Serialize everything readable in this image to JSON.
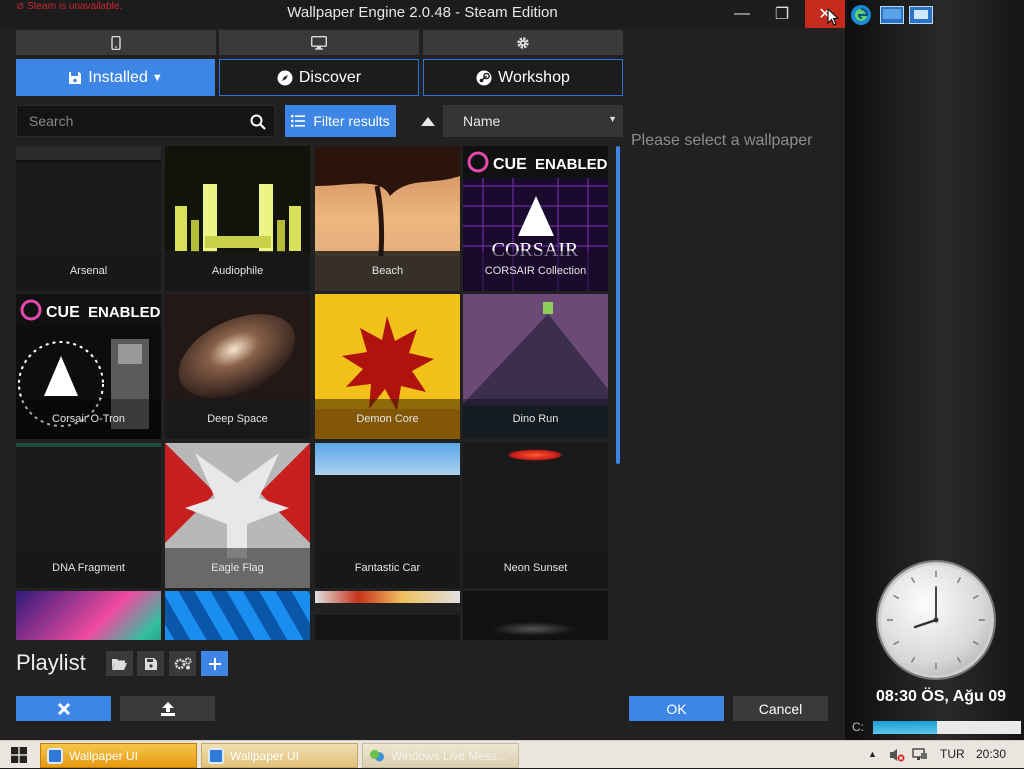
{
  "window": {
    "steam_warning": "Steam is unavailable.",
    "title": "Wallpaper Engine 2.0.48 - Steam Edition",
    "controls": {
      "minimize": "—",
      "restore": "❐",
      "close": "✕"
    }
  },
  "device_tabs": [
    {
      "name": "phone",
      "icon": "phone-icon"
    },
    {
      "name": "monitor",
      "icon": "monitor-icon"
    },
    {
      "name": "settings",
      "icon": "gear-icon"
    }
  ],
  "main_tabs": {
    "installed": "Installed",
    "discover": "Discover",
    "workshop": "Workshop"
  },
  "toolbar": {
    "search_placeholder": "Search",
    "filter_label": "Filter results",
    "sort_value": "Name"
  },
  "wallpapers": [
    {
      "title": "Arsenal"
    },
    {
      "title": "Audiophile"
    },
    {
      "title": "Beach"
    },
    {
      "title": "CORSAIR Collection"
    },
    {
      "title": "Corsair O-Tron"
    },
    {
      "title": "Deep Space"
    },
    {
      "title": "Demon Core"
    },
    {
      "title": "Dino Run"
    },
    {
      "title": "DNA Fragment"
    },
    {
      "title": "Eagle Flag"
    },
    {
      "title": "Fantastic Car"
    },
    {
      "title": "Neon Sunset"
    }
  ],
  "badges": {
    "icue": "CUE",
    "enabled": "ENABLED",
    "corsair": "CORSAIR"
  },
  "preview_hint": "Please select a wallpaper",
  "playlist": {
    "title": "Playlist"
  },
  "footer": {
    "ok": "OK",
    "cancel": "Cancel"
  },
  "taskbar": {
    "items": [
      "Wallpaper UI",
      "Wallpaper UI",
      "Windows Live Mess..."
    ],
    "language": "TUR",
    "time": "20:30"
  },
  "desktop": {
    "clock_text": "08:30 ÖS, Ağu 09",
    "drive_label": "C:",
    "drive_usage": 0.43
  },
  "colors": {
    "accent": "#3e86e6",
    "close": "#c42b1c",
    "background": "#212121"
  }
}
